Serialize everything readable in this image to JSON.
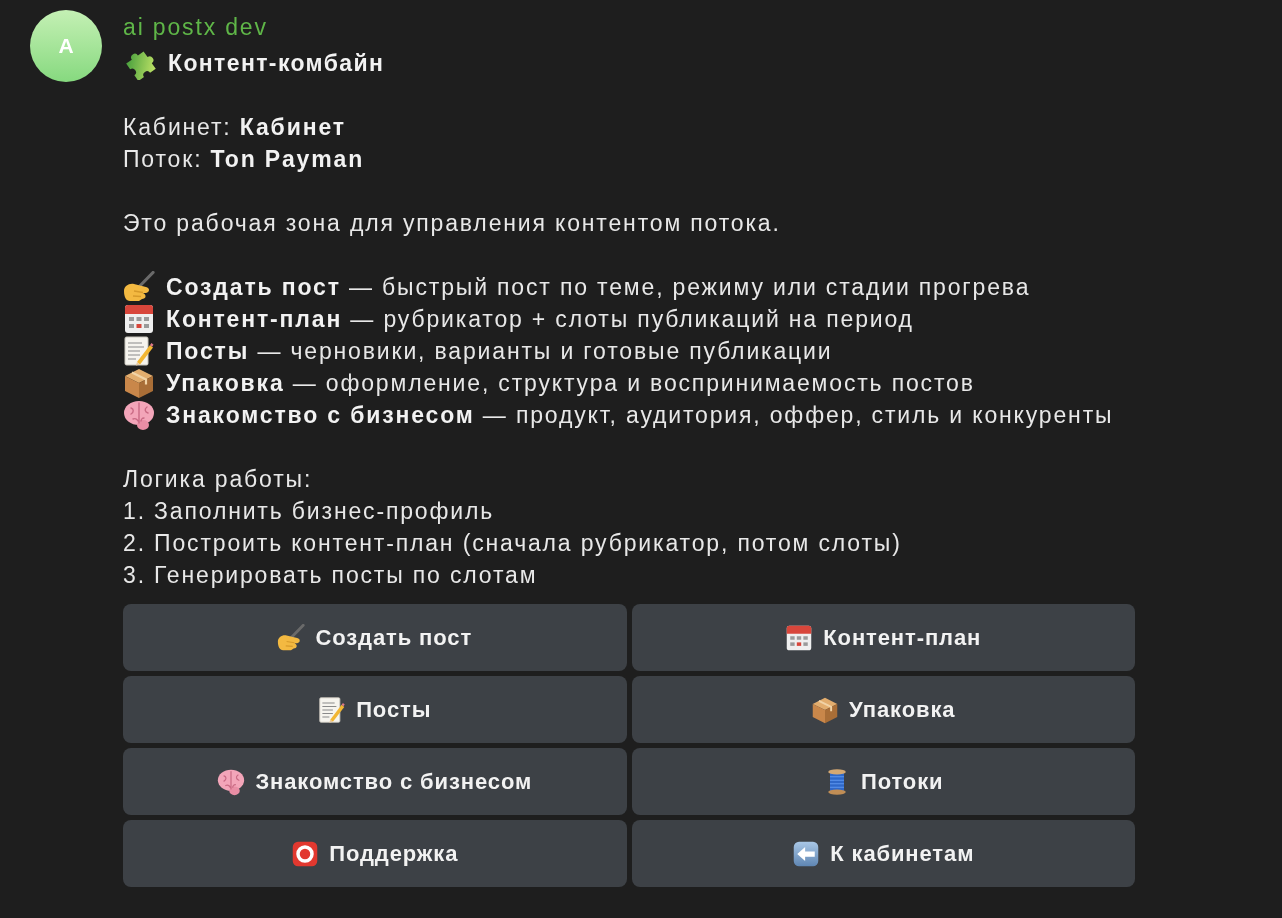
{
  "message": {
    "avatar": {
      "letter": "A"
    },
    "sender": "ai postx dev",
    "title": "Контент-комбайн",
    "fields": [
      "Кабинет: **Кабинет**",
      "Поток: **Ton Payman**"
    ],
    "intro": "Это рабочая зона для управления контентом потока.",
    "features": [
      "**Создать пост** — быстрый пост по теме, режиму или стадии прогрева",
      "**Контент-план** — рубрикатор + слоты публикаций на период",
      "**Посты** — черновики, варианты и готовые публикации",
      "**Упаковка** — оформление, структура и воспринимаемость постов",
      "**Знакомство с бизнесом** — продукт, аудитория, оффер, стиль и конкуренты"
    ],
    "logic": {
      "heading": "Логика работы:",
      "steps": [
        "1. Заполнить бизнес-профиль",
        "2. Построить контент-план (сначала рубрикатор, потом слоты)",
        "3. Генерировать посты по слотам"
      ]
    }
  },
  "keyboard": [
    "Создать пост",
    "Контент-план",
    "Посты",
    "Упаковка",
    "Знакомство с бизнесом",
    "Потоки",
    "Поддержка",
    "К кабинетам"
  ]
}
